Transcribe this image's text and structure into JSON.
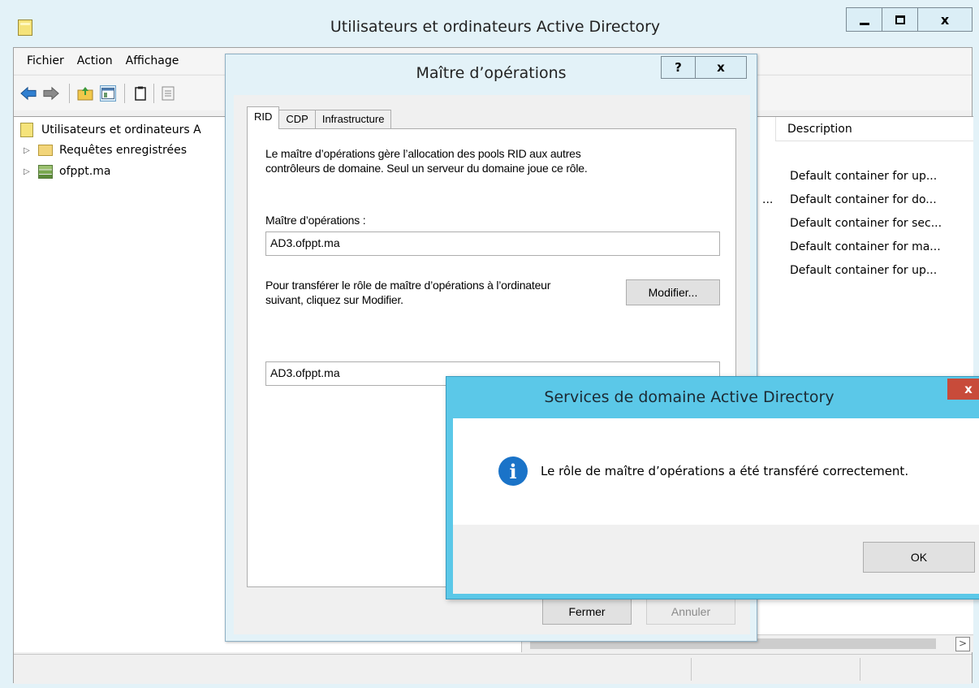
{
  "main_window": {
    "title": "Utilisateurs et ordinateurs Active Directory",
    "controls": {
      "minimize": "minimize",
      "maximize": "maximize",
      "close": "x"
    }
  },
  "menubar": [
    "Fichier",
    "Action",
    "Affichage"
  ],
  "toolbar": [
    "back-arrow-icon",
    "forward-arrow-icon",
    "up-folder-icon",
    "console-tree-icon",
    "clipboard-icon",
    "export-list-icon"
  ],
  "tree": {
    "root": "Utilisateurs et ordinateurs A",
    "items": [
      {
        "label": "Requêtes enregistrées",
        "expander": "▷"
      },
      {
        "label": "ofppt.ma",
        "expander": "▷"
      }
    ]
  },
  "list": {
    "column_header": "Description",
    "rows": [
      "Default container for up...",
      "Default container for do...",
      "Default container for sec...",
      "Default container for ma...",
      "Default container for up..."
    ],
    "truncated_fragment": "...",
    "scroll_right": ">"
  },
  "ops_dialog": {
    "title": "Maître d’opérations",
    "help": "?",
    "close": "x",
    "tabs": [
      "RID",
      "CDP",
      "Infrastructure"
    ],
    "active_tab": "RID",
    "description_line1": "Le maître d’opérations gère l’allocation des pools RID aux autres",
    "description_line2": "contrôleurs de domaine. Seul un serveur du domaine joue ce rôle.",
    "master_label": "Maître d’opérations :",
    "master_value": "AD3.ofppt.ma",
    "transfer_line1": "Pour transférer le rôle de maître d’opérations à l’ordinateur",
    "transfer_line2": "suivant, cliquez sur Modifier.",
    "modify_button": "Modifier...",
    "target_value": "AD3.ofppt.ma",
    "close_button": "Fermer",
    "cancel_button": "Annuler"
  },
  "message_box": {
    "title": "Services de domaine Active Directory",
    "close": "x",
    "icon": "info-icon",
    "icon_glyph": "i",
    "message": "Le rôle de maître d’opérations a été transféré correctement.",
    "ok_button": "OK"
  },
  "colors": {
    "window_frame": "#e3f2f8",
    "message_frame": "#5bc8e8",
    "close_red": "#c84b3a",
    "info_blue": "#1a73c8"
  }
}
